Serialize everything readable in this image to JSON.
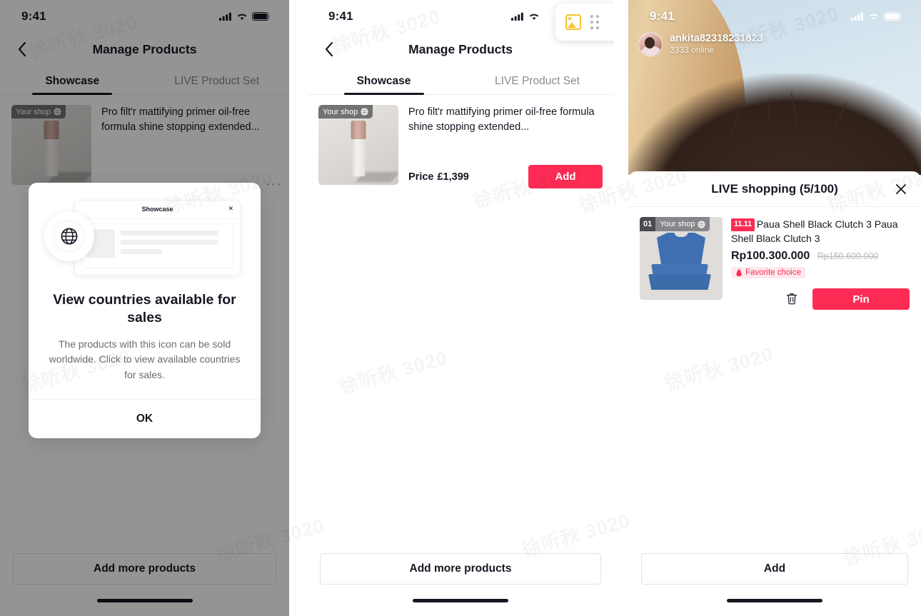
{
  "panel1": {
    "status": {
      "time": "9:41",
      "signal_icon": "cellular-signal-icon",
      "wifi_icon": "wifi-icon",
      "battery_icon": "battery-icon"
    },
    "nav": {
      "back_icon": "back-chevron-icon",
      "title": "Manage Products"
    },
    "tabs": [
      {
        "label": "Showcase",
        "active": true
      },
      {
        "label": "LIVE Product Set",
        "active": false
      }
    ],
    "product": {
      "shop_badge": "Your shop",
      "globe_icon": "globe-icon",
      "title": "Pro filt'r mattifying primer oil-free formula shine stopping extended...",
      "more_icon": "ellipsis-icon"
    },
    "cta": "Add more products",
    "modal": {
      "art": {
        "card_title": "Showcase",
        "close_icon": "close-icon",
        "globe_icon": "globe-icon"
      },
      "title": "View countries available for sales",
      "body": "The products with this icon can be sold worldwide. Click to view available countries for sales.",
      "ok": "OK"
    }
  },
  "panel2": {
    "status": {
      "time": "9:41",
      "signal_icon": "cellular-signal-icon",
      "wifi_icon": "wifi-icon"
    },
    "float_tool": {
      "image_icon": "image-picture-icon",
      "grid_icon": "grid-dots-icon",
      "accent": "#f9c12c"
    },
    "nav": {
      "back_icon": "back-chevron-icon",
      "title": "Manage Products"
    },
    "tabs": [
      {
        "label": "Showcase",
        "active": true
      },
      {
        "label": "LIVE Product Set",
        "active": false
      }
    ],
    "product": {
      "shop_badge": "Your shop",
      "globe_icon": "globe-icon",
      "title": "Pro filt'r mattifying primer oil-free formula shine stopping extended...",
      "price_label": "Price",
      "price_value": "£1,399",
      "add_label": "Add"
    },
    "cta": "Add more products"
  },
  "panel3": {
    "status": {
      "time": "9:41",
      "signal_icon": "cellular-signal-icon",
      "wifi_icon": "wifi-icon",
      "battery_icon": "battery-icon"
    },
    "live": {
      "username": "ankita82318231823",
      "online": "2333 online",
      "avatar_icon": "avatar"
    },
    "sheet": {
      "title": "LIVE shopping (5/100)",
      "close_icon": "close-icon",
      "item": {
        "index": "01",
        "shop_badge": "Your shop",
        "globe_icon": "globe-icon",
        "promo_tag": "11.11",
        "title": "Paua Shell Black Clutch 3 Paua Shell Black Clutch 3",
        "price": "Rp100.300.000",
        "price_original": "Rp150.600.000",
        "favorite_badge": "Favorite choice",
        "favorite_icon": "flame-icon",
        "delete_icon": "trash-icon",
        "pin_label": "Pin"
      }
    },
    "cta": "Add"
  },
  "watermark": {
    "text": "徐听秋 3020"
  },
  "colors": {
    "accent_red": "#fe2c55",
    "accent_yellow": "#f9c12c",
    "text_primary": "#161823",
    "text_muted": "#8a8b91"
  }
}
